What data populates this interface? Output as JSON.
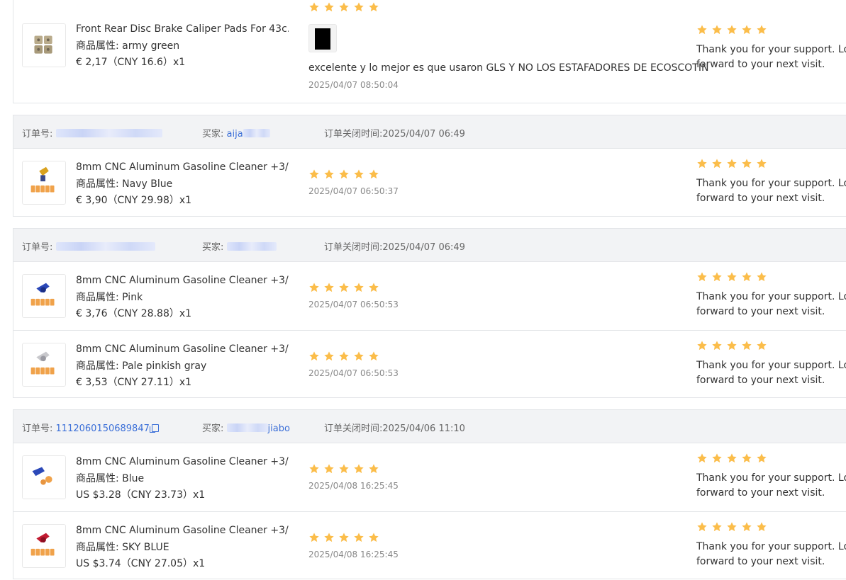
{
  "colors": {
    "star": "#fbbd4a",
    "link": "#3b6fd8",
    "header_bg": "#f2f3f5"
  },
  "labels": {
    "order_no": "订单号:",
    "buyer": "买家:",
    "closed_time": "订单关闭时间:",
    "attr_prefix": "商品属性:"
  },
  "orders": [
    {
      "items": [
        {
          "title": "Front Rear Disc Brake Caliper Pads For 43c...",
          "attr": "商品属性:  army green",
          "price": "€ 2,17（CNY  16.6）x1",
          "rating": 5,
          "review_text": "excelente y lo mejor es que usaron GLS Y NO LOS ESTAFADORES DE ECOSCOTIN",
          "review_time": "2025/04/07 08:50:04",
          "reply_rating": 5,
          "reply_line1": "Thank you for your support. Look",
          "reply_line2": "forward to your next visit."
        }
      ]
    },
    {
      "order_no": "",
      "buyer": "aija",
      "closed_time": "订单关闭时间:2025/04/07 06:49",
      "items": [
        {
          "title": "8mm CNC Aluminum Gasoline Cleaner +3/...",
          "attr": "商品属性:  Navy Blue",
          "price": "€ 3,90（CNY  29.98）x1",
          "rating": 5,
          "review_time": "2025/04/07 06:50:37",
          "reply_rating": 5,
          "reply_line1": "Thank you for your support. Look",
          "reply_line2": "forward to your next visit."
        }
      ]
    },
    {
      "order_no": "",
      "buyer": "",
      "closed_time": "订单关闭时间:2025/04/07 06:49",
      "items": [
        {
          "title": "8mm CNC Aluminum Gasoline Cleaner +3/...",
          "attr": "商品属性:  Pink",
          "price": "€ 3,76（CNY  28.88）x1",
          "rating": 5,
          "review_time": "2025/04/07 06:50:53",
          "reply_rating": 5,
          "reply_line1": "Thank you for your support. Look",
          "reply_line2": "forward to your next visit."
        },
        {
          "title": "8mm CNC Aluminum Gasoline Cleaner +3/...",
          "attr": "商品属性:  Pale pinkish gray",
          "price": "€ 3,53（CNY  27.11）x1",
          "rating": 5,
          "review_time": "2025/04/07 06:50:53",
          "reply_rating": 5,
          "reply_line1": "Thank you for your support. Look",
          "reply_line2": "forward to your next visit."
        }
      ]
    },
    {
      "order_no": "1112060150689847",
      "buyer": "jiabo",
      "closed_time": "订单关闭时间:2025/04/06 11:10",
      "items": [
        {
          "title": "8mm CNC Aluminum Gasoline Cleaner +3/...",
          "attr": "商品属性:  Blue",
          "price": "US $3.28（CNY  23.73）x1",
          "rating": 5,
          "review_time": "2025/04/08 16:25:45",
          "reply_rating": 5,
          "reply_line1": "Thank you for your support. Look",
          "reply_line2": "forward to your next visit."
        },
        {
          "title": "8mm CNC Aluminum Gasoline Cleaner +3/...",
          "attr": "商品属性:  SKY BLUE",
          "price": "US $3.74（CNY  27.05）x1",
          "rating": 5,
          "review_time": "2025/04/08 16:25:45",
          "reply_rating": 5,
          "reply_line1": "Thank you for your support. Look",
          "reply_line2": "forward to your next visit."
        }
      ]
    }
  ]
}
